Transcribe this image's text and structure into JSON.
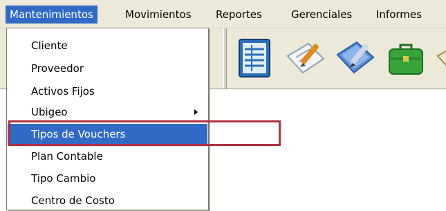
{
  "menubar": {
    "items": [
      {
        "label": "Mantenimientos",
        "active": true
      },
      {
        "label": "Movimientos",
        "active": false
      },
      {
        "label": "Reportes",
        "active": false
      },
      {
        "label": "Gerenciales",
        "active": false
      },
      {
        "label": "Informes",
        "active": false
      }
    ]
  },
  "toolbar": {
    "buttons": [
      {
        "icon": "ledger-book-icon"
      },
      {
        "icon": "document-pen-icon"
      },
      {
        "icon": "blue-document-pen-icon"
      },
      {
        "icon": "briefcase-icon"
      },
      {
        "icon": "partial-icon"
      }
    ]
  },
  "dropdown": {
    "items": [
      {
        "label": "Cliente",
        "has_submenu": false
      },
      {
        "label": "Proveedor",
        "has_submenu": false
      },
      {
        "label": "Activos Fijos",
        "has_submenu": false
      },
      {
        "label": "Ubigeo",
        "has_submenu": true
      },
      {
        "label": "Tipos de Vouchers",
        "has_submenu": false,
        "highlighted": true
      },
      {
        "label": "Plan Contable",
        "has_submenu": false
      },
      {
        "label": "Tipo Cambio",
        "has_submenu": false
      },
      {
        "label": "Centro de Costo",
        "has_submenu": false
      }
    ]
  },
  "colors": {
    "menu_highlight": "#316ac5",
    "annotation_border": "#b03040",
    "chrome": "#ece9d8"
  }
}
